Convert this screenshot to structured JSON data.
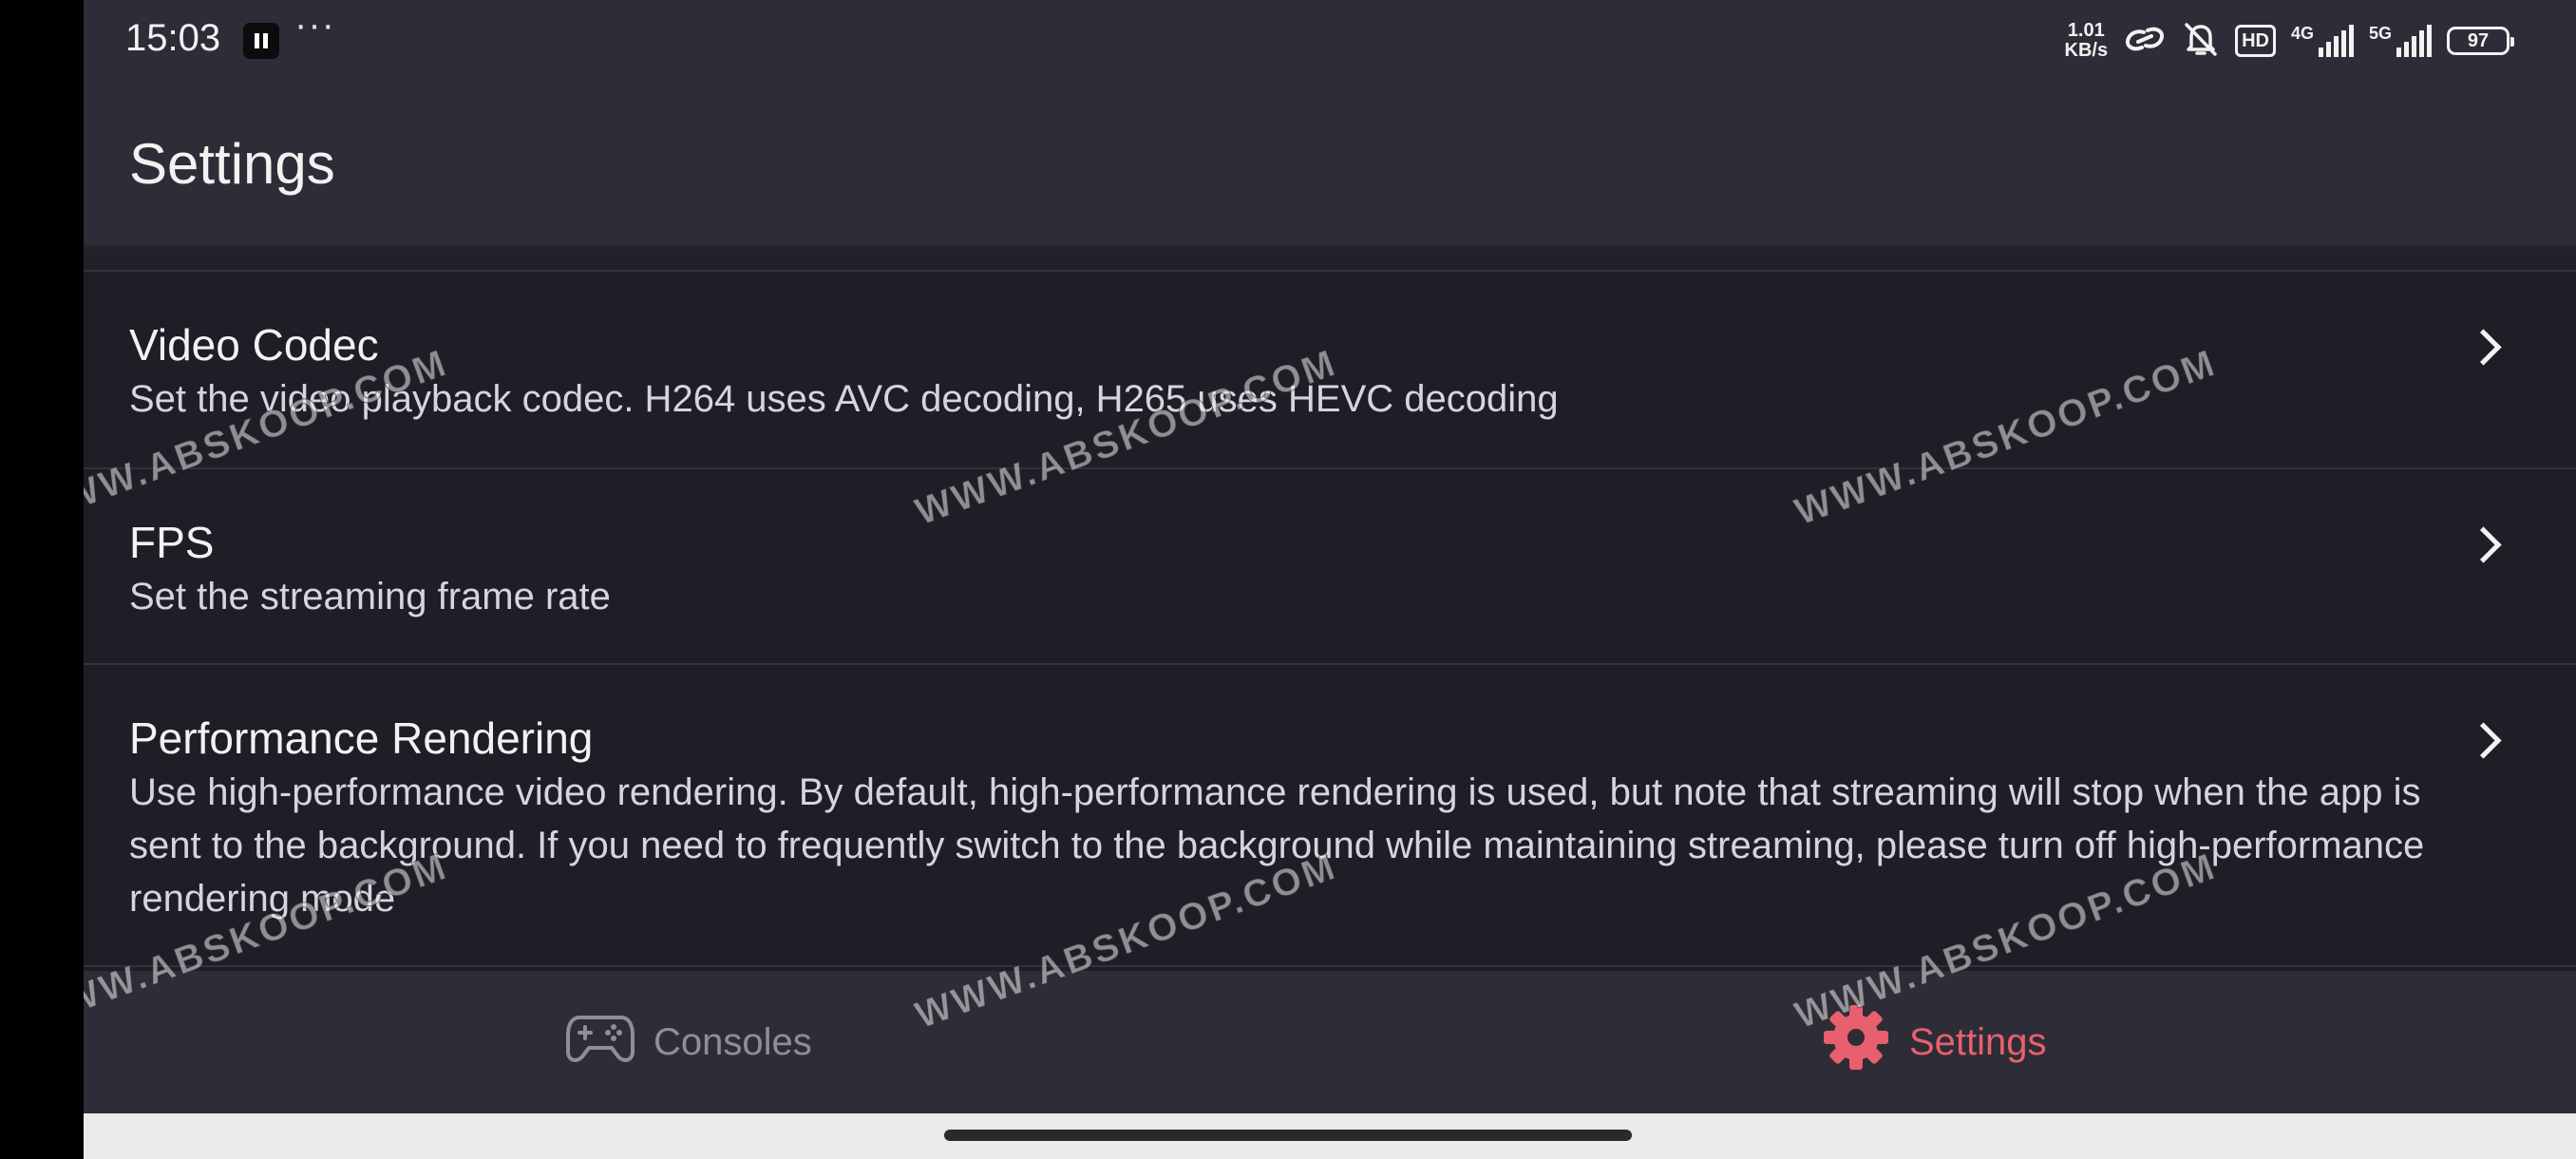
{
  "status_bar": {
    "time": "15:03",
    "more": "···",
    "net_speed_value": "1.01",
    "net_speed_unit": "KB/s",
    "hd_badge": "HD",
    "signal1_tag": "4G",
    "signal2_tag": "5G",
    "battery": "97"
  },
  "header": {
    "title": "Settings"
  },
  "settings": [
    {
      "title": "Video Codec",
      "description": "Set the video playback codec. H264 uses AVC decoding, H265 uses HEVC decoding"
    },
    {
      "title": "FPS",
      "description": "Set the streaming frame rate"
    },
    {
      "title": "Performance Rendering",
      "description": "Use high-performance video rendering. By default, high-performance rendering is used, but note that streaming will stop when the app is sent to the background. If you need to frequently switch to the background while maintaining streaming, please turn off high-performance rendering mode"
    }
  ],
  "bottom_nav": {
    "consoles_label": "Consoles",
    "settings_label": "Settings",
    "active": "Settings"
  },
  "watermark": "WWW.ABSKOOP.COM",
  "colors": {
    "accent": "#e8606e",
    "background": "#1f1e26",
    "header": "#2e2d37",
    "inactive_nav": "#8f8e96"
  },
  "icons": {
    "consoles": "gamepad-icon",
    "settings": "gear-icon",
    "row_action": "chevron-right-icon"
  }
}
